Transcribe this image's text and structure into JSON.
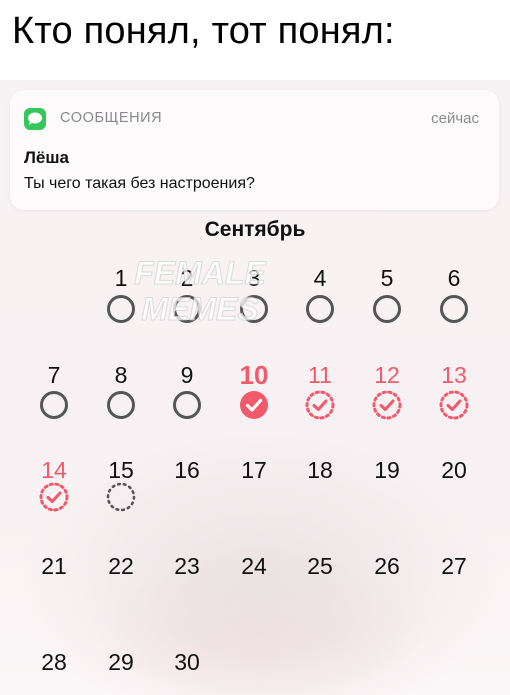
{
  "caption": "Кто понял, тот понял:",
  "notification": {
    "app_name": "СООБЩЕНИЯ",
    "time": "сейчас",
    "sender": "Лёша",
    "message": "Ты чего такая без настроения?"
  },
  "calendar": {
    "month": "Сентябрь",
    "days": [
      {
        "n": "1",
        "color": "black",
        "mark": "empty"
      },
      {
        "n": "2",
        "color": "black",
        "mark": "empty"
      },
      {
        "n": "3",
        "color": "black",
        "mark": "empty"
      },
      {
        "n": "4",
        "color": "black",
        "mark": "empty"
      },
      {
        "n": "5",
        "color": "black",
        "mark": "empty"
      },
      {
        "n": "6",
        "color": "black",
        "mark": "empty"
      },
      {
        "n": "7",
        "color": "black",
        "mark": "empty"
      },
      {
        "n": "8",
        "color": "black",
        "mark": "empty"
      },
      {
        "n": "9",
        "color": "black",
        "mark": "empty"
      },
      {
        "n": "10",
        "color": "red",
        "mark": "today-check"
      },
      {
        "n": "11",
        "color": "red",
        "mark": "predicted-check"
      },
      {
        "n": "12",
        "color": "red",
        "mark": "predicted-check"
      },
      {
        "n": "13",
        "color": "red",
        "mark": "predicted-check"
      },
      {
        "n": "14",
        "color": "red",
        "mark": "predicted-check"
      },
      {
        "n": "15",
        "color": "black",
        "mark": "dotted"
      },
      {
        "n": "16",
        "color": "black",
        "mark": "none"
      },
      {
        "n": "17",
        "color": "black",
        "mark": "none"
      },
      {
        "n": "18",
        "color": "black",
        "mark": "none"
      },
      {
        "n": "19",
        "color": "black",
        "mark": "none"
      },
      {
        "n": "20",
        "color": "black",
        "mark": "none"
      },
      {
        "n": "21",
        "color": "black",
        "mark": "none"
      },
      {
        "n": "22",
        "color": "black",
        "mark": "none"
      },
      {
        "n": "23",
        "color": "black",
        "mark": "none"
      },
      {
        "n": "24",
        "color": "black",
        "mark": "none"
      },
      {
        "n": "25",
        "color": "black",
        "mark": "none"
      },
      {
        "n": "26",
        "color": "black",
        "mark": "none"
      },
      {
        "n": "27",
        "color": "black",
        "mark": "none"
      },
      {
        "n": "28",
        "color": "black",
        "mark": "none"
      },
      {
        "n": "29",
        "color": "black",
        "mark": "none"
      },
      {
        "n": "30",
        "color": "black",
        "mark": "none"
      }
    ],
    "first_weekday_column": 1
  },
  "watermark": {
    "line1": "FEMALE",
    "line2": "MEMES"
  },
  "colors": {
    "accent_red": "#f05a6b",
    "messages_green": "#34c759",
    "ring_gray": "#555555"
  }
}
